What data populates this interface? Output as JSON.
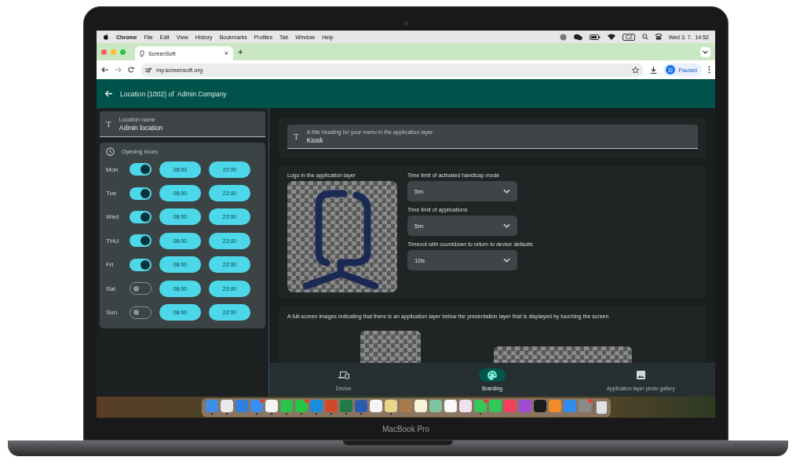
{
  "device": {
    "model": "MacBook Pro"
  },
  "menu_bar": {
    "app": "Chrome",
    "items": [
      "File",
      "Edit",
      "View",
      "History",
      "Bookmarks",
      "Profiles",
      "Tab",
      "Window",
      "Help"
    ],
    "keyboard": "CZ",
    "clock": "Wed 3. 7.  14:52"
  },
  "browser": {
    "tab": {
      "title": "ScreenSoft",
      "close": "×"
    },
    "new_tab": "+",
    "url": "my.screensoft.org",
    "profile": {
      "initial": "D",
      "status": "Paused"
    }
  },
  "header": {
    "title": "Location (1002) of  Admin Company"
  },
  "location_field": {
    "icon": "T",
    "label": "Location name",
    "value": "Admin location"
  },
  "opening_hours": {
    "title": "Opening hours",
    "days": [
      {
        "day": "Mon",
        "on": true,
        "open": "08:00",
        "close": "22:00"
      },
      {
        "day": "Tue",
        "on": true,
        "open": "08:00",
        "close": "22:00"
      },
      {
        "day": "Wed",
        "on": true,
        "open": "08:00",
        "close": "22:00"
      },
      {
        "day": "THU",
        "on": true,
        "open": "08:00",
        "close": "22:00"
      },
      {
        "day": "Fri",
        "on": true,
        "open": "08:00",
        "close": "22:00"
      },
      {
        "day": "Sat",
        "on": false,
        "open": "08:00",
        "close": "22:00"
      },
      {
        "day": "Sun",
        "on": false,
        "open": "08:00",
        "close": "22:00"
      }
    ]
  },
  "title_field": {
    "icon": "T",
    "label": "A title heading for your menu in the application layer",
    "value": "Kiosk"
  },
  "logo": {
    "label": "Logo in the application layer"
  },
  "selects": [
    {
      "label": "Time limit of activated handicap mode",
      "value": "5m"
    },
    {
      "label": "Time limit of applications",
      "value": "5m"
    },
    {
      "label": "Timeout with countdown to return to device defaults",
      "value": "10s"
    }
  ],
  "fullscreen_images": {
    "label": "A full-screen images indicating that there is an application layer below the presentation layer that is displayed by touching the screen"
  },
  "bottom_nav": [
    {
      "kind": "device",
      "label": "Device",
      "selected": false
    },
    {
      "kind": "palette",
      "label": "Branding",
      "selected": true
    },
    {
      "kind": "image",
      "label": "Application layer photo gallery",
      "selected": false
    }
  ],
  "dock": [
    {
      "color": "#3d8ee8",
      "running": true,
      "badge": false
    },
    {
      "color": "#e9e9e9",
      "running": true,
      "badge": false
    },
    {
      "color": "#2f7fe0",
      "running": false,
      "badge": false
    },
    {
      "color": "#3b8ff0",
      "running": true,
      "badge": true
    },
    {
      "color": "#f4f4f4",
      "running": true,
      "badge": false
    },
    {
      "color": "#2dc24b",
      "running": true,
      "badge": false
    },
    {
      "color": "#25c545",
      "running": true,
      "badge": true
    },
    {
      "color": "#1a8ce0",
      "running": true,
      "badge": false
    },
    {
      "color": "#d04a2a",
      "running": true,
      "badge": false
    },
    {
      "color": "#1f7a45",
      "running": true,
      "badge": false
    },
    {
      "color": "#2b5cb0",
      "running": true,
      "badge": false
    },
    {
      "color": "#f5f5f5",
      "running": false,
      "badge": false
    },
    {
      "color": "#e8d68a",
      "running": true,
      "badge": false
    },
    {
      "color": "#a77c4a",
      "running": false,
      "badge": false
    },
    {
      "color": "#f7f2d8",
      "running": false,
      "badge": false
    },
    {
      "color": "#7ec4a0",
      "running": false,
      "badge": false
    },
    {
      "color": "#fafafa",
      "running": false,
      "badge": false
    },
    {
      "color": "#f0e0f0",
      "running": false,
      "badge": false
    },
    {
      "color": "#35c759",
      "running": true,
      "badge": true
    },
    {
      "color": "#2fc95a",
      "running": false,
      "badge": false
    },
    {
      "color": "#f2405a",
      "running": false,
      "badge": false
    },
    {
      "color": "#a04ad8",
      "running": false,
      "badge": false
    },
    {
      "color": "#1c1c1e",
      "running": false,
      "badge": false
    },
    {
      "color": "#f08c2a",
      "running": false,
      "badge": false
    },
    {
      "color": "#2f8cf0",
      "running": false,
      "badge": false
    },
    {
      "color": "#8a8a8a",
      "running": false,
      "badge": true
    }
  ]
}
